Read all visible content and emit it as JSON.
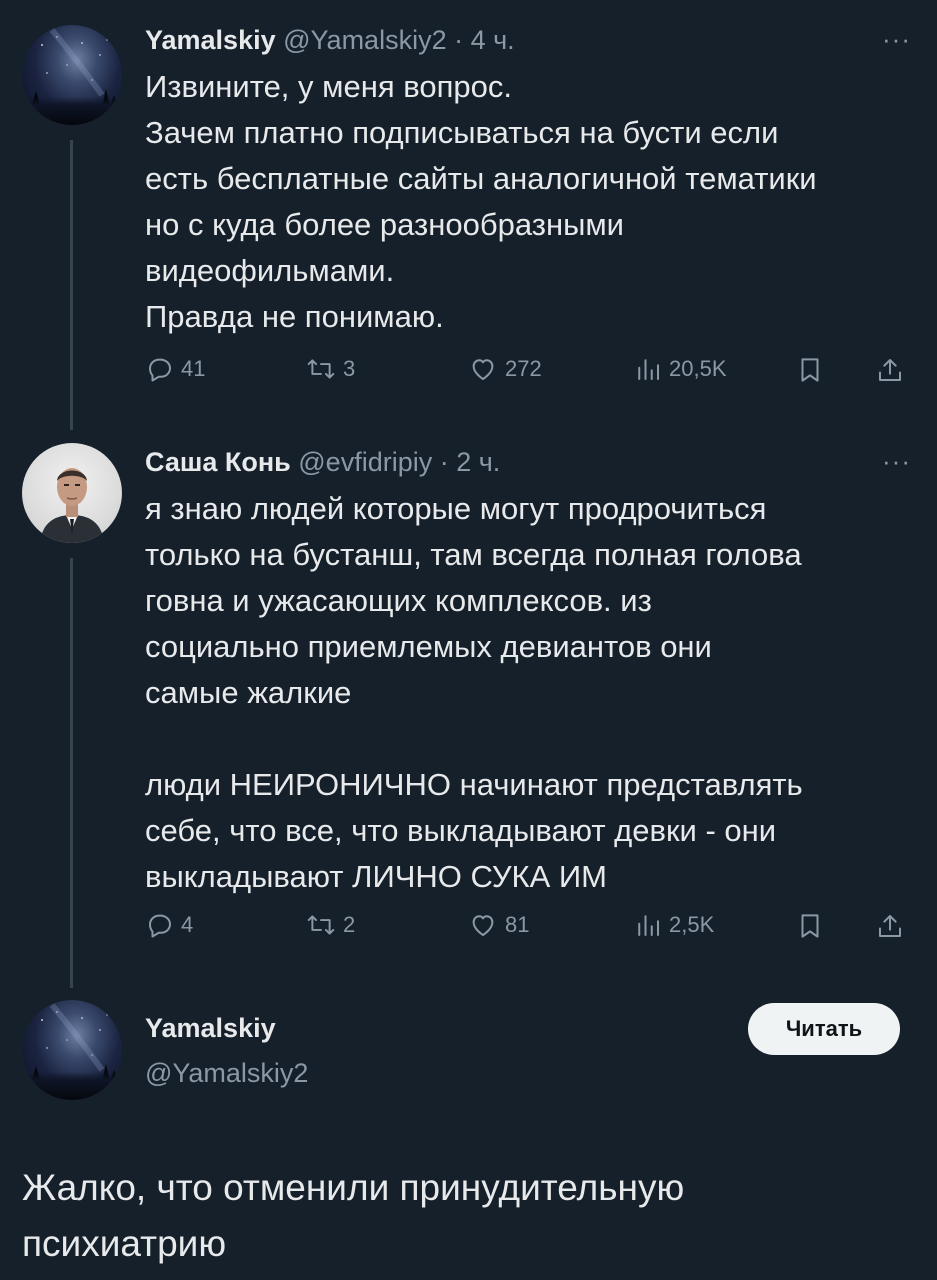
{
  "tweet1": {
    "name": "Yamalskiy",
    "handle_time": "@Yamalskiy2 · 4 ч.",
    "more": "···",
    "lines": [
      "Извините, у меня вопрос.",
      "Зачем платно подписываться на бусти если",
      "есть бесплатные сайты аналогичной тематики",
      "но с куда более разнообразными",
      "видеофильмами.",
      "Правда не понимаю."
    ],
    "replies": "41",
    "retweets": "3",
    "likes": "272",
    "views": "20,5K"
  },
  "tweet2": {
    "name": "Саша Конь",
    "handle_time": "@evfidripiy · 2 ч.",
    "more": "···",
    "lines": [
      "я знаю людей которые могут продрочиться",
      "только на бустанш, там всегда полная голова",
      "говна и ужасающих комплексов. из",
      "социально приемлемых девиантов они",
      "самые жалкие",
      "",
      "люди НЕИРОНИЧНО начинают представлять",
      "себе, что все, что выкладывают девки - они",
      "выкладывают ЛИЧНО СУКА ИМ"
    ],
    "replies": "4",
    "retweets": "2",
    "likes": "81",
    "views": "2,5K"
  },
  "tweet3": {
    "name": "Yamalskiy",
    "handle": "@Yamalskiy2",
    "follow_label": "Читать",
    "lines": [
      "Жалко, что отменили принудительную",
      "психиатрию"
    ]
  },
  "colors": {
    "background": "#15202b",
    "text": "#e7e9ea",
    "muted": "#8b98a5",
    "thread_line": "#38444d",
    "button_bg": "#eff3f4"
  },
  "icons": [
    "reply-icon",
    "retweet-icon",
    "like-icon",
    "views-icon",
    "bookmark-icon",
    "share-icon",
    "more-icon"
  ]
}
